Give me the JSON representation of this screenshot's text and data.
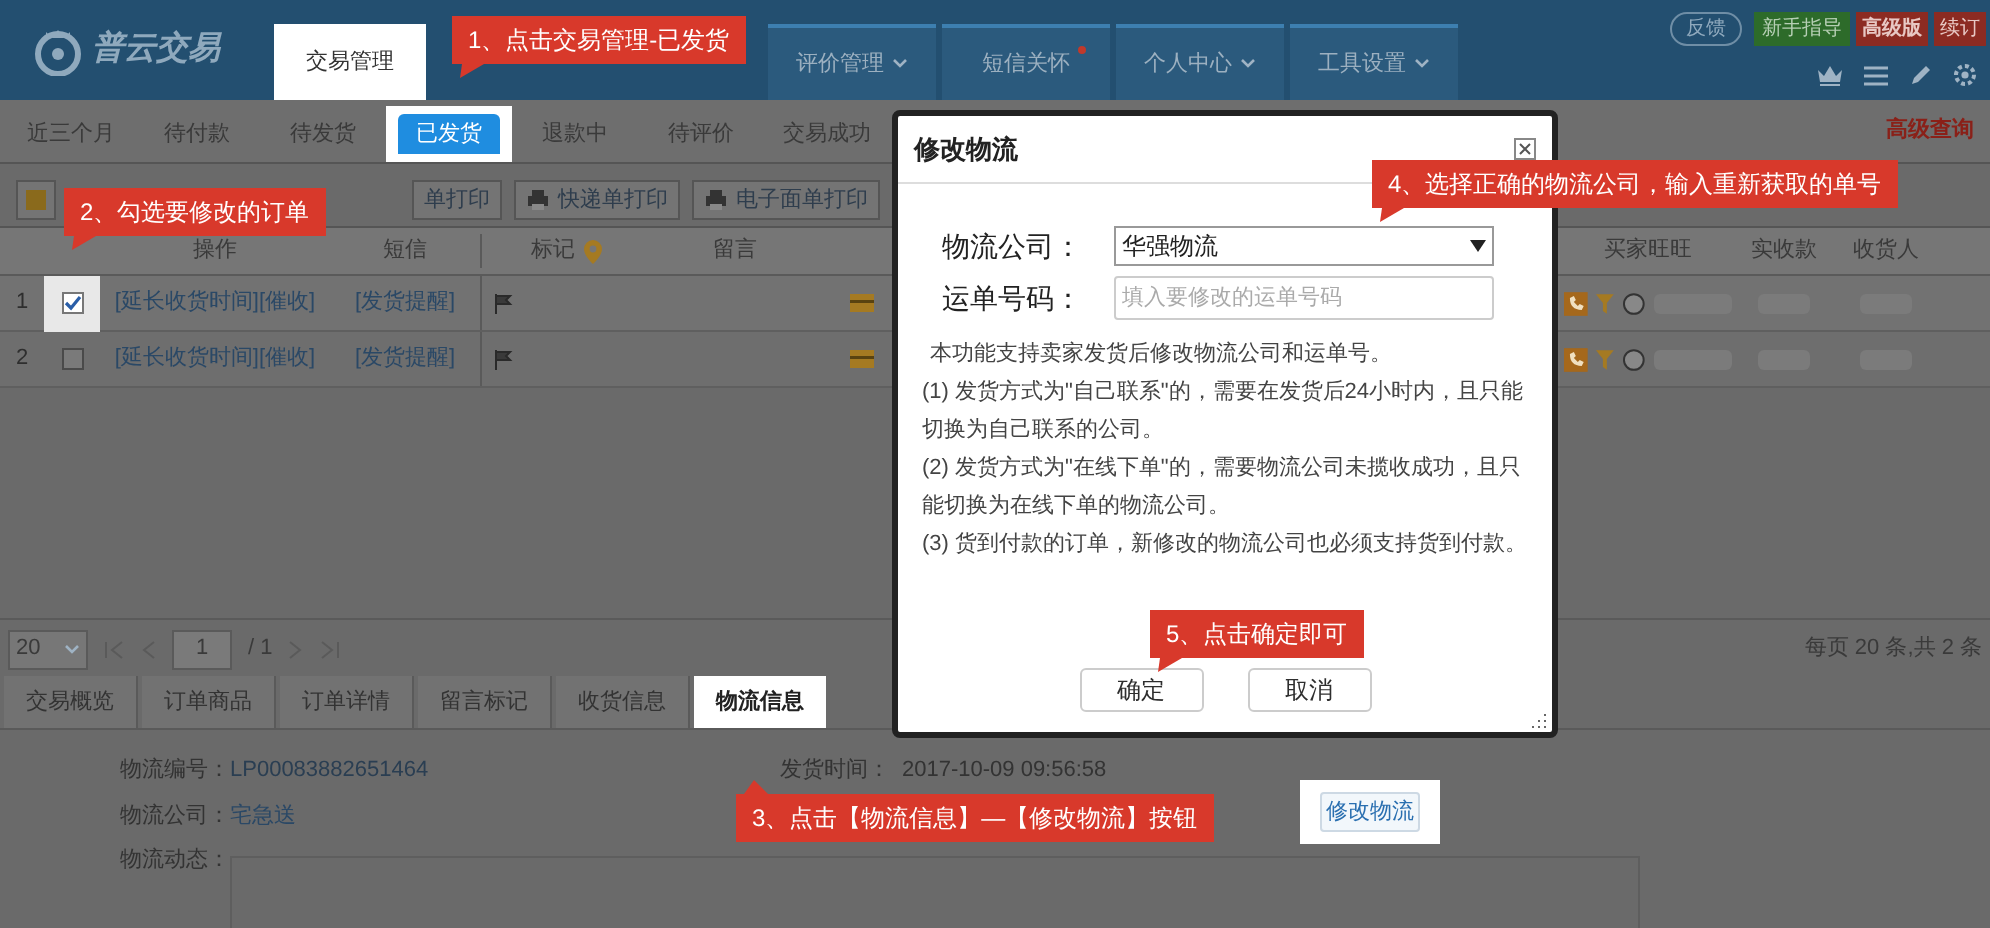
{
  "header": {
    "logo": "普云交易",
    "nav": [
      {
        "label": "交易管理",
        "selected": true,
        "dropdown": false,
        "badge": false
      },
      {
        "label": "评价管理",
        "selected": false,
        "dropdown": true,
        "badge": false
      },
      {
        "label": "短信关怀",
        "selected": false,
        "dropdown": false,
        "badge": true
      },
      {
        "label": "个人中心",
        "selected": false,
        "dropdown": true,
        "badge": false
      },
      {
        "label": "工具设置",
        "selected": false,
        "dropdown": true,
        "badge": false
      }
    ],
    "feedback": "反馈",
    "guide": "新手指导",
    "edition": "高级版",
    "renew": "续订"
  },
  "subtabs": [
    {
      "label": "近三个月",
      "selected": false
    },
    {
      "label": "待付款",
      "selected": false
    },
    {
      "label": "待发货",
      "selected": false
    },
    {
      "label": "已发货",
      "selected": true
    },
    {
      "label": "退款中",
      "selected": false
    },
    {
      "label": "待评价",
      "selected": false
    },
    {
      "label": "交易成功",
      "selected": false
    }
  ],
  "advanced_search": "高级查询",
  "toolbar": [
    "单打印",
    "快递单打印",
    "电子面单打印"
  ],
  "table": {
    "columns": [
      "操作",
      "短信",
      "标记",
      "留言"
    ],
    "right_columns": [
      "买家旺旺",
      "实收款",
      "收货人"
    ],
    "rows": [
      {
        "index": "1",
        "checked": true,
        "spotlight": true,
        "actions": "[延长收货时间][催收]",
        "sms": "[发货提醒]"
      },
      {
        "index": "2",
        "checked": false,
        "spotlight": false,
        "actions": "[延长收货时间][催收]",
        "sms": "[发货提醒]"
      }
    ]
  },
  "pager": {
    "page_size": "20",
    "page": "1",
    "total_pages": "/ 1",
    "summary": "每页 20 条,共 2 条"
  },
  "detail_tabs": [
    {
      "label": "交易概览",
      "selected": false
    },
    {
      "label": "订单商品",
      "selected": false
    },
    {
      "label": "订单详情",
      "selected": false
    },
    {
      "label": "留言标记",
      "selected": false
    },
    {
      "label": "收货信息",
      "selected": false
    },
    {
      "label": "物流信息",
      "selected": true
    }
  ],
  "logistics": {
    "number_label": "物流编号：",
    "number": "LP00083882651464",
    "company_label": "物流公司：",
    "company": "宅急送",
    "tracking_label": "物流动态：",
    "ship_time_label": "发货时间：",
    "ship_time": "2017-10-09 09:56:58",
    "modify_button": "修改物流"
  },
  "dialog": {
    "title": "修改物流",
    "company_label": "物流公司：",
    "company_value": "华强物流",
    "waybill_label": "运单号码：",
    "waybill_placeholder": "填入要修改的运单号码",
    "notes": [
      "本功能支持卖家发货后修改物流公司和运单号。",
      "(1) 发货方式为\"自己联系\"的，需要在发货后24小时内，且只能切换为自己联系的公司。",
      "(2) 发货方式为\"在线下单\"的，需要物流公司未揽收成功，且只能切换为在线下单的物流公司。",
      "(3) 货到付款的订单，新修改的物流公司也必须支持货到付款。"
    ],
    "confirm": "确定",
    "cancel": "取消"
  },
  "annotations": [
    "1、点击交易管理-已发货",
    "2、勾选要修改的订单",
    "3、点击【物流信息】—【修改物流】按钮",
    "4、选择正确的物流公司，输入重新获取的单号",
    "5、点击确定即可"
  ]
}
